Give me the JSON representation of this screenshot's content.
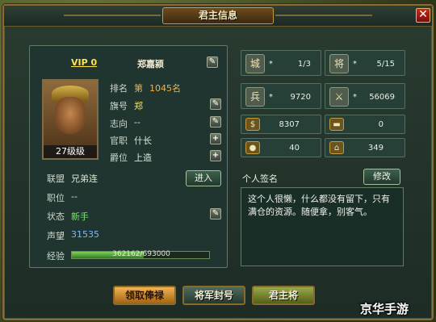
{
  "window": {
    "title": "君主信息",
    "close": "✕"
  },
  "profile": {
    "vip": "VIP 0",
    "name": "郑嘉颍",
    "level_badge": "27级级",
    "rows": {
      "rank": {
        "label": "排名",
        "prefix": "第",
        "value": "1045名"
      },
      "flag": {
        "label": "旗号",
        "value": "郑"
      },
      "aim": {
        "label": "志向",
        "value": "--"
      },
      "official": {
        "label": "官职",
        "value": "什长"
      },
      "title": {
        "label": "爵位",
        "value": "上造"
      },
      "alliance": {
        "label": "联盟",
        "value": "兄弟连",
        "button": "进入"
      },
      "position": {
        "label": "职位",
        "value": "--"
      },
      "status": {
        "label": "状态",
        "value": "新手"
      },
      "prestige": {
        "label": "声望",
        "value": "31535"
      },
      "exp": {
        "label": "经验",
        "value": "362162/693000",
        "progress": 0.5226
      }
    }
  },
  "stats": [
    {
      "icon": "city-icon",
      "star": "*",
      "value": "1/3"
    },
    {
      "icon": "general-icon",
      "star": "*",
      "value": "5/15"
    },
    {
      "icon": "soldier-icon",
      "star": "*",
      "value": "9720"
    },
    {
      "icon": "swords-icon",
      "star": "*",
      "value": "56069"
    },
    {
      "icon": "gold-coins-icon",
      "value": "8307"
    },
    {
      "icon": "gold-bar-icon",
      "value": "0"
    },
    {
      "icon": "food-icon",
      "value": "40"
    },
    {
      "icon": "house-icon",
      "value": "349"
    }
  ],
  "signature": {
    "label": "个人签名",
    "edit": "修改",
    "text": "这个人很懒，什么都没有留下，只有满仓的资源。随便拿，别客气。"
  },
  "buttons": {
    "salary": "领取俸禄",
    "general_title": "将军封号",
    "lord_general": "君主将"
  },
  "watermark": "京华手游",
  "colors": {
    "gold": "#f1b24a",
    "green": "#7fe07a",
    "blue": "#7ab8ff",
    "yellow": "#ffe34a"
  }
}
